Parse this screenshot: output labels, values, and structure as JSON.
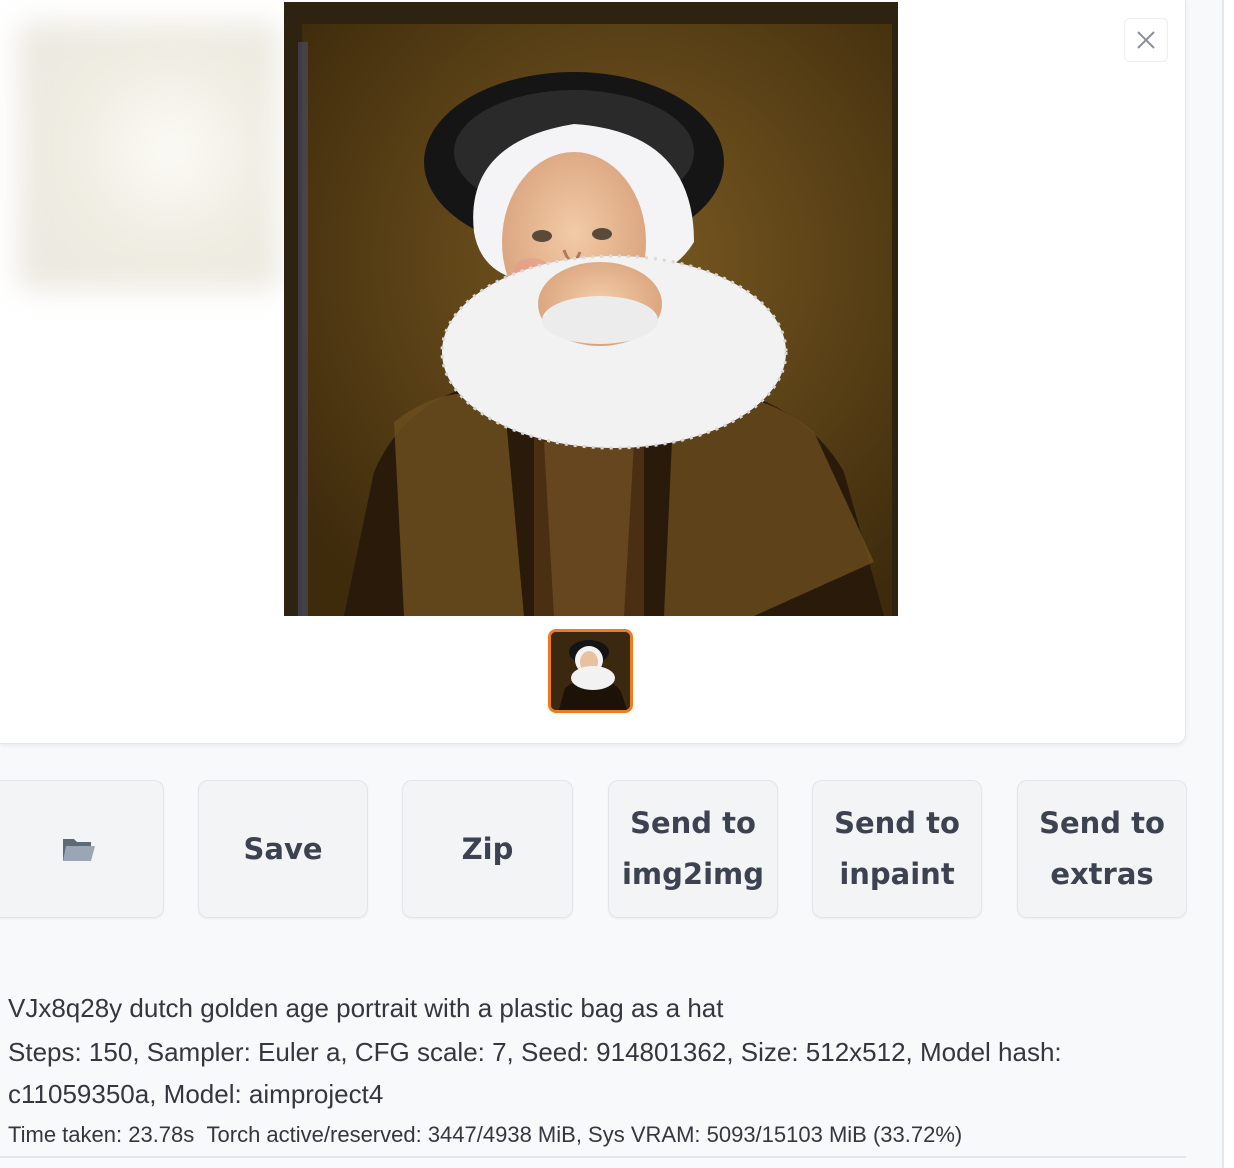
{
  "gallery": {
    "close_icon": "close-icon"
  },
  "buttons": {
    "folder_icon": "folder-icon",
    "save_label": "Save",
    "zip_label": "Zip",
    "send_img2img_line1": "Send to",
    "send_img2img_line2": "img2img",
    "send_inpaint_line1": "Send to",
    "send_inpaint_line2": "inpaint",
    "send_extras_line1": "Send to",
    "send_extras_line2": "extras"
  },
  "info": {
    "prompt": "VJx8q28y dutch golden age portrait with a plastic bag as a hat",
    "params": "Steps: 150, Sampler: Euler a, CFG scale: 7, Seed: 914801362, Size: 512x512, Model hash: c11059350a, Model: aimproject4",
    "perf_time": "Time taken: 23.78s",
    "perf_memory": "Torch active/reserved: 3447/4938 MiB, Sys VRAM: 5093/15103 MiB (33.72%)"
  },
  "colors": {
    "accent": "#f07b1e",
    "button_bg": "#f3f4f6",
    "text": "#333740"
  }
}
